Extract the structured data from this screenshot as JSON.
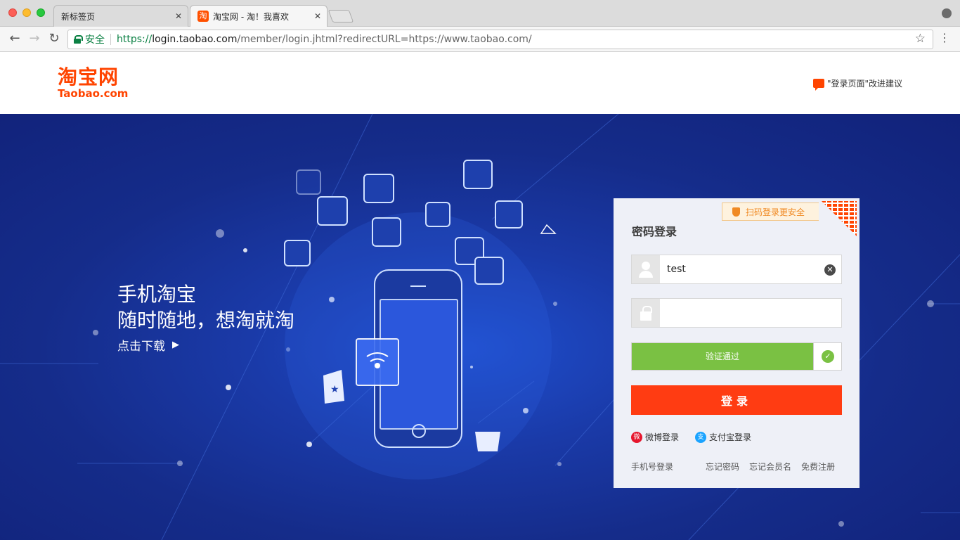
{
  "browser": {
    "tabs": [
      {
        "title": "新标签页",
        "close": "✕"
      },
      {
        "title": "淘宝网 - 淘！我喜欢",
        "close": "✕",
        "favicon": "淘"
      }
    ],
    "security_label": "安全",
    "url": {
      "scheme": "https://",
      "host": "login.taobao.com",
      "path": "/member/login.jhtml?redirectURL=https://www.taobao.com/"
    },
    "nav": {
      "back": "←",
      "forward": "→",
      "reload": "↻",
      "star": "☆",
      "menu": "⋮"
    }
  },
  "header": {
    "logo_cn": "淘宝网",
    "logo_en": "Taobao.com",
    "feedback": "\"登录页面\"改进建议"
  },
  "banner": {
    "title": "手机淘宝",
    "subtitle": "随时随地，想淘就淘",
    "download": "点击下载",
    "download_arrow": "▶"
  },
  "login": {
    "qr_badge": "扫码登录更安全",
    "title": "密码登录",
    "username": {
      "value": "test",
      "placeholder": ""
    },
    "password": {
      "value": "",
      "placeholder": ""
    },
    "clear_icon": "✕",
    "slider_label": "验证通过",
    "slider_check": "✓",
    "submit": "登录",
    "weibo": "微博登录",
    "alipay": "支付宝登录",
    "phone_login": "手机号登录",
    "forgot_password": "忘记密码",
    "forgot_member": "忘记会员名",
    "register": "免费注册"
  },
  "colors": {
    "brand": "#ff4400",
    "login_button": "#ff3c12",
    "slider_success": "#7ac143",
    "banner_blue": "#152c8a"
  }
}
